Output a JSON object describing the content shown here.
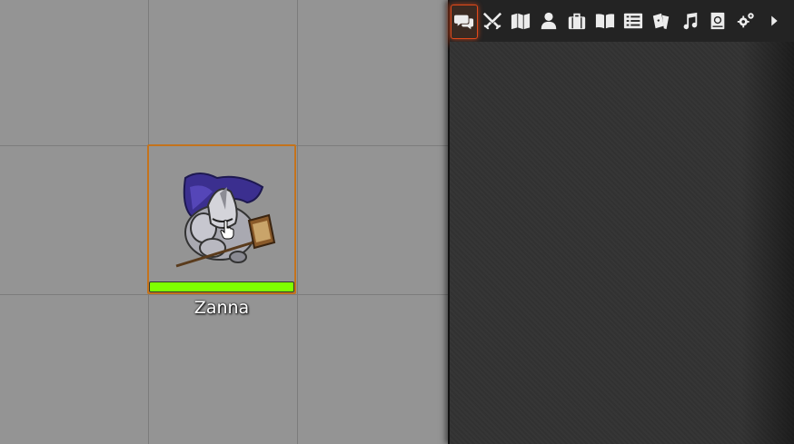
{
  "canvas": {
    "background_color": "#949494",
    "grid_color": "#7c7c7c"
  },
  "token": {
    "name": "Zanna",
    "hp_fraction": 1.0,
    "hp_color": "#7fff00",
    "selected": true,
    "selection_color": "#c4731c"
  },
  "sidebar": {
    "accent_color": "#e2491a",
    "active_tab": "chat",
    "tabs": [
      {
        "id": "chat",
        "icon": "chat-bubbles-icon"
      },
      {
        "id": "combat",
        "icon": "crossed-swords-icon"
      },
      {
        "id": "scenes",
        "icon": "map-icon"
      },
      {
        "id": "actors",
        "icon": "user-icon"
      },
      {
        "id": "items",
        "icon": "suitcase-icon"
      },
      {
        "id": "journal",
        "icon": "open-book-icon"
      },
      {
        "id": "tables",
        "icon": "list-icon"
      },
      {
        "id": "cards",
        "icon": "cards-icon"
      },
      {
        "id": "playlists",
        "icon": "music-note-icon"
      },
      {
        "id": "compendium",
        "icon": "atlas-icon"
      },
      {
        "id": "settings",
        "icon": "cogs-icon"
      },
      {
        "id": "collapse",
        "icon": "caret-right-icon"
      }
    ]
  }
}
